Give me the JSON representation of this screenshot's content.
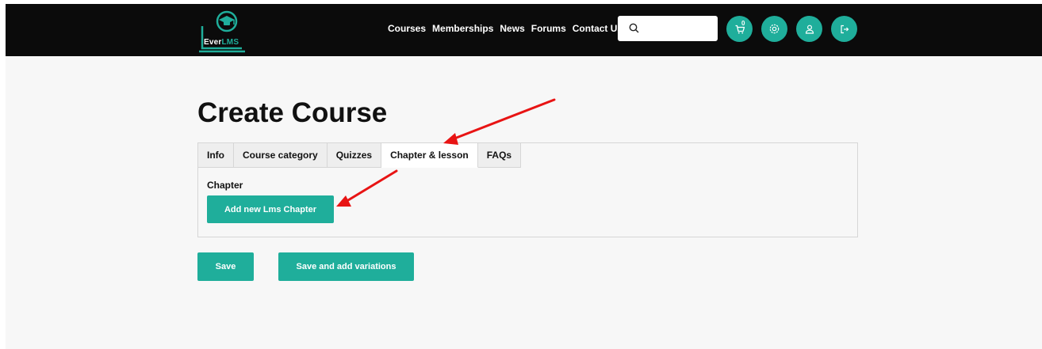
{
  "logo": {
    "prefix": "Ever",
    "suffix": "LMS"
  },
  "nav": {
    "items": [
      "Courses",
      "Memberships",
      "News",
      "Forums",
      "Contact Us"
    ]
  },
  "search": {
    "placeholder": "",
    "value": ""
  },
  "header_icons": {
    "cart": {
      "icon": "cart-icon",
      "count": "0"
    },
    "settings": {
      "icon": "gear-icon"
    },
    "account": {
      "icon": "user-icon"
    },
    "logout": {
      "icon": "logout-icon"
    }
  },
  "page_title": "Create Course",
  "tabs": [
    {
      "label": "Info",
      "active": false
    },
    {
      "label": "Course category",
      "active": false
    },
    {
      "label": "Quizzes",
      "active": false
    },
    {
      "label": "Chapter & lesson",
      "active": true
    },
    {
      "label": "FAQs",
      "active": false
    }
  ],
  "chapter": {
    "label": "Chapter",
    "add_button": "Add new Lms Chapter"
  },
  "actions": {
    "save": "Save",
    "save_variations": "Save and add variations"
  },
  "colors": {
    "accent": "#1fae9b",
    "header_bg": "#0b0b0b",
    "page_bg": "#f7f7f7",
    "annotation_arrow": "#e81414"
  }
}
